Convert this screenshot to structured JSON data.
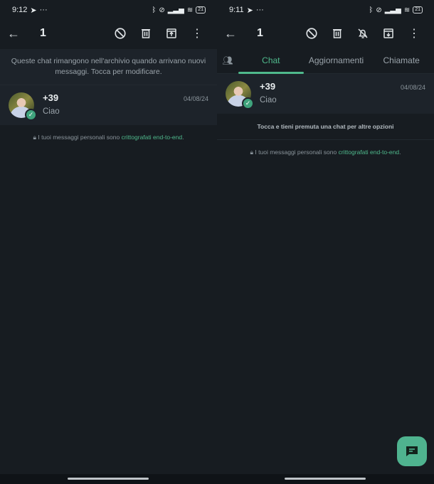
{
  "left_screen": {
    "status": {
      "time": "9:12",
      "telegram_icon": "send-icon",
      "more": "···",
      "battery": "21"
    },
    "appbar": {
      "back_icon": "arrow-back-icon",
      "selected_count": "1",
      "actions": [
        "block-icon",
        "trash-icon",
        "unarchive-icon",
        "more-vert-icon"
      ]
    },
    "banner": "Queste chat rimangono nell'archivio quando arrivano nuovi messaggi. Tocca per modificare.",
    "chat": {
      "name": "+39",
      "date": "04/08/24",
      "message": "Ciao"
    },
    "e2e": {
      "prefix": "I tuoi messaggi personali sono ",
      "link": "crittografati end-to-end",
      "suffix": "."
    }
  },
  "right_screen": {
    "status": {
      "time": "9:11",
      "more": "···",
      "battery": "21"
    },
    "appbar": {
      "selected_count": "1",
      "actions": [
        "block-icon",
        "trash-icon",
        "mute-icon",
        "archive-icon",
        "more-vert-icon"
      ]
    },
    "tabs": [
      {
        "label": "Chat",
        "active": true
      },
      {
        "label": "Aggiornamenti",
        "active": false
      },
      {
        "label": "Chiamate",
        "active": false
      }
    ],
    "chat": {
      "name": "+39",
      "date": "04/08/24",
      "message": "Ciao"
    },
    "hint": "Tocca e tieni premuta una chat per altre opzioni",
    "e2e": {
      "prefix": "I tuoi messaggi personali sono ",
      "link": "crittografati end-to-end",
      "suffix": "."
    }
  },
  "colors": {
    "accent": "#4fb98c",
    "background": "#171c21",
    "fab": "#4fb38f"
  }
}
